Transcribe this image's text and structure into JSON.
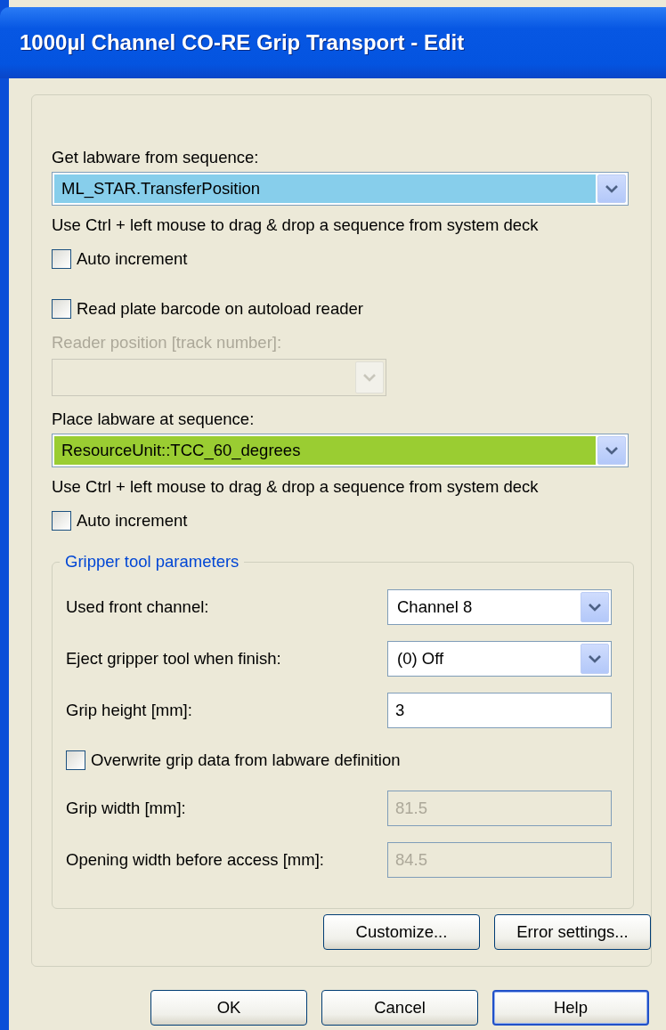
{
  "window": {
    "title": "1000µl Channel CO-RE Grip Transport - Edit"
  },
  "sequences": [
    {
      "label": "Get labware from sequence:",
      "value": "ML_STAR.TransferPosition",
      "color": "#87ceeb",
      "hint": "Use Ctrl + left mouse to drag & drop a sequence from system deck",
      "auto_increment": {
        "label": "Auto increment",
        "checked": false
      },
      "barcode": {
        "label": "Read plate barcode on autoload reader",
        "checked": false
      },
      "reader": {
        "label": "Reader position [track number]:",
        "disabled": true
      }
    },
    {
      "label": "Place labware at sequence:",
      "value": "ResourceUnit::TCC_60_degrees",
      "color": "#9acd32",
      "hint": "Use Ctrl + left mouse to drag & drop a sequence from system deck",
      "auto_increment": {
        "label": "Auto increment",
        "checked": false
      }
    }
  ],
  "gripper": {
    "title": "Gripper tool parameters",
    "fields": [
      {
        "kind": "dropdown",
        "label": "Used front channel:",
        "value": "Channel 8",
        "disabled": false
      },
      {
        "kind": "dropdown",
        "label": "Eject gripper tool when finish:",
        "value": "(0) Off",
        "disabled": false
      },
      {
        "kind": "text",
        "label": "Grip height [mm]:",
        "value": "3",
        "disabled": false
      }
    ],
    "overwrite": {
      "label": "Overwrite grip data from labware definition",
      "checked": false
    },
    "grip_fields": [
      {
        "kind": "text",
        "label": "Grip width [mm]:",
        "value": "81.5",
        "disabled": true
      },
      {
        "kind": "text",
        "label": "Opening width before access [mm]:",
        "value": "84.5",
        "disabled": true
      }
    ]
  },
  "group_buttons": [
    {
      "label": "Customize...",
      "default": false
    },
    {
      "label": "Error settings...",
      "default": false
    }
  ],
  "buttons": [
    {
      "label": "OK",
      "default": false
    },
    {
      "label": "Cancel",
      "default": false
    },
    {
      "label": "Help",
      "default": true
    }
  ]
}
